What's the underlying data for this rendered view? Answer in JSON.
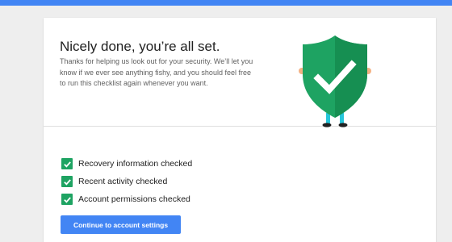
{
  "header": {
    "accent_color": "#4285f4"
  },
  "success": {
    "title": "Nicely done, you’re all set.",
    "description": "Thanks for helping us look out for your security. We’ll let you know if we ever see anything fishy, and you should feel free to run this checklist again whenever you want.",
    "illustration_icon": "shield-check-character"
  },
  "checklist": {
    "check_color": "#1ea362",
    "items": [
      {
        "label": "Recovery information checked",
        "checked": true
      },
      {
        "label": "Recent activity checked",
        "checked": true
      },
      {
        "label": "Account permissions checked",
        "checked": true
      }
    ]
  },
  "actions": {
    "continue_label": "Continue to account settings",
    "button_color": "#4285f4"
  }
}
